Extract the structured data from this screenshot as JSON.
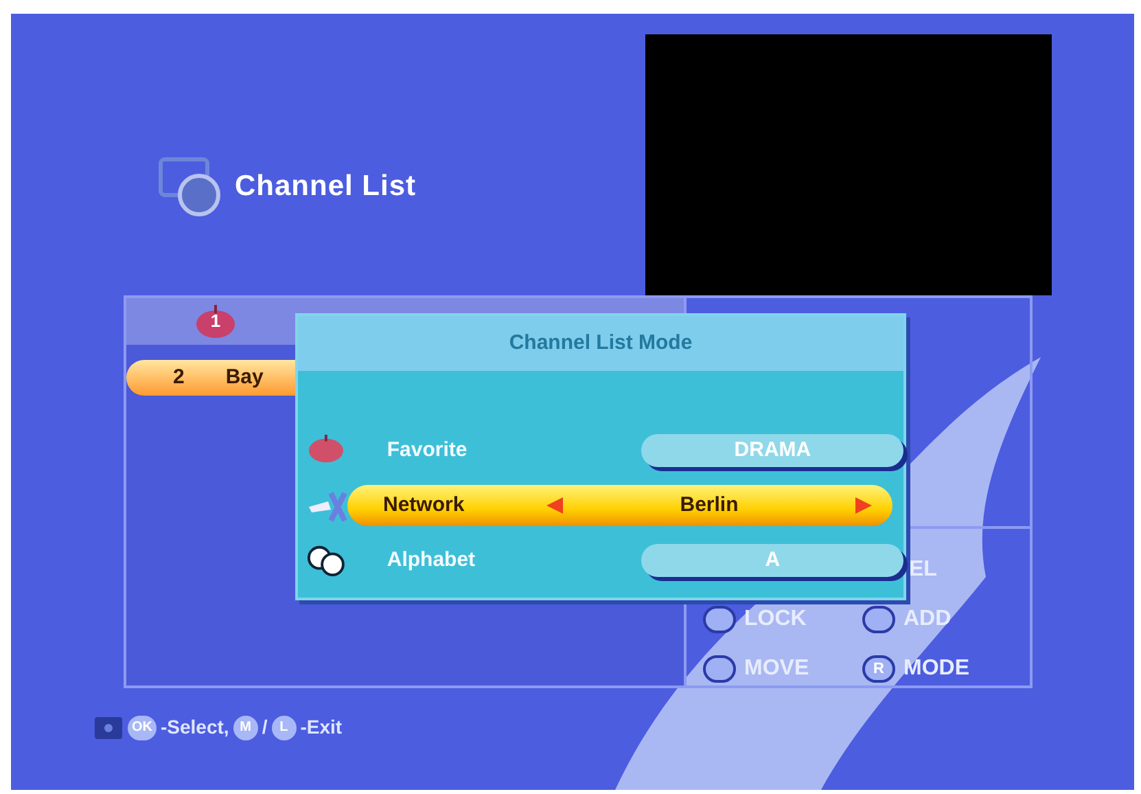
{
  "title": "Channel List",
  "channel_list": {
    "group_badge": "1",
    "rows": [
      {
        "number": "2",
        "name": "Bay",
        "selected": true
      }
    ]
  },
  "legend": [
    {
      "label": "EL"
    },
    {
      "label": "LOCK"
    },
    {
      "label": "ADD"
    },
    {
      "label": "MOVE"
    },
    {
      "key": "R",
      "label": "MODE"
    }
  ],
  "popup": {
    "title": "Channel List Mode",
    "rows": [
      {
        "kind": "favorite",
        "label": "Favorite",
        "value": "DRAMA",
        "selected": false
      },
      {
        "kind": "network",
        "label": "Network",
        "value": "Berlin",
        "selected": true
      },
      {
        "kind": "alphabet",
        "label": "Alphabet",
        "value": "A",
        "selected": false
      }
    ]
  },
  "footer": [
    {
      "kind": "key",
      "text": "OK"
    },
    {
      "kind": "text",
      "text": "-Select,"
    },
    {
      "kind": "key",
      "text": "M"
    },
    {
      "kind": "text",
      "text": "/"
    },
    {
      "kind": "key",
      "text": "L"
    },
    {
      "kind": "text",
      "text": "-Exit"
    }
  ]
}
